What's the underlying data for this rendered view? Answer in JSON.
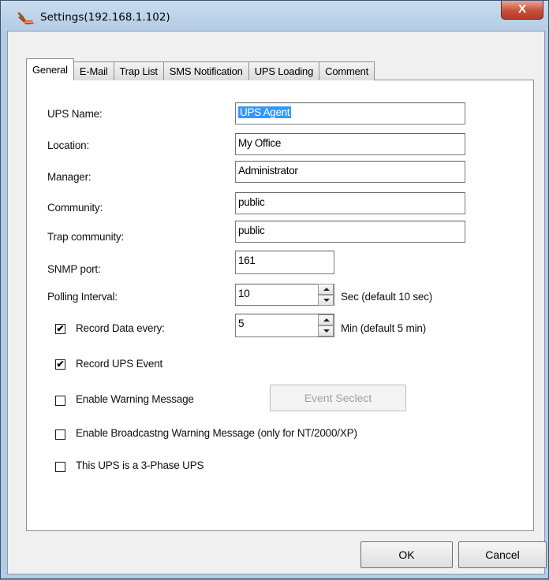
{
  "window": {
    "title": "Settings(192.168.1.102)",
    "close_glyph": "X"
  },
  "tabs": [
    {
      "label": "General",
      "active": true
    },
    {
      "label": "E-Mail"
    },
    {
      "label": "Trap List"
    },
    {
      "label": "SMS Notification"
    },
    {
      "label": "UPS Loading"
    },
    {
      "label": "Comment"
    }
  ],
  "form": {
    "ups_name": {
      "label": "UPS Name:",
      "value": "UPS Agent"
    },
    "location": {
      "label": "Location:",
      "value": "My Office"
    },
    "manager": {
      "label": "Manager:",
      "value": "Administrator"
    },
    "community": {
      "label": "Community:",
      "value": "public"
    },
    "trap_community": {
      "label": "Trap community:",
      "value": "public"
    },
    "snmp_port": {
      "label": "SNMP port:",
      "value": "161"
    },
    "polling_interval": {
      "label": "Polling Interval:",
      "value": "10",
      "hint": "Sec (default 10 sec)"
    },
    "record_data": {
      "label": "Record Data every:",
      "checked": true,
      "value": "5",
      "hint": "Min (default 5 min)"
    },
    "record_event": {
      "label": "Record UPS Event",
      "checked": true
    },
    "enable_warning": {
      "label": "Enable Warning Message",
      "checked": false
    },
    "event_select_button": "Event Seclect",
    "enable_broadcast": {
      "label": "Enable Broadcastng Warning Message (only for NT/2000/XP)",
      "checked": false
    },
    "three_phase": {
      "label": "This UPS is a 3-Phase UPS",
      "checked": false
    }
  },
  "footer": {
    "ok_label": "OK",
    "cancel_label": "Cancel"
  },
  "icons": {
    "app": "wrench-icon",
    "close": "close-icon",
    "check": "✔"
  }
}
